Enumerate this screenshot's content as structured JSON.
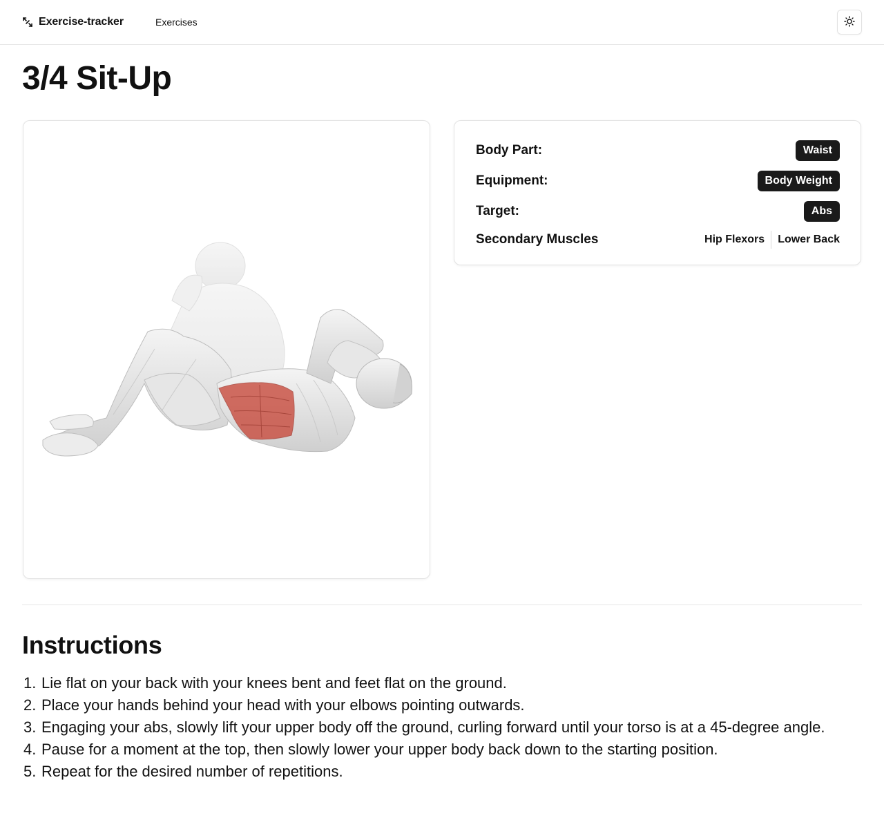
{
  "navbar": {
    "brand_icon": "arrows-diagonal-icon",
    "brand": "Exercise-tracker",
    "links": [
      "Exercises"
    ],
    "theme_toggle_icon": "sun-icon"
  },
  "exercise": {
    "title": "3/4 Sit-Up",
    "illustration": "situp-illustration",
    "details": {
      "body_part_label": "Body Part:",
      "body_part": "Waist",
      "equipment_label": "Equipment:",
      "equipment": "Body Weight",
      "target_label": "Target:",
      "target": "Abs",
      "secondary_label": "Secondary Muscles",
      "secondary_muscles": [
        "Hip Flexors",
        "Lower Back"
      ]
    }
  },
  "instructions": {
    "heading": "Instructions",
    "steps": [
      "Lie flat on your back with your knees bent and feet flat on the ground.",
      "Place your hands behind your head with your elbows pointing outwards.",
      "Engaging your abs, slowly lift your upper body off the ground, curling forward until your torso is at a 45-degree angle.",
      "Pause for a moment at the top, then slowly lower your upper body back down to the starting position.",
      "Repeat for the desired number of repetitions."
    ],
    "numbers": [
      "1.",
      "2.",
      "3.",
      "4.",
      "5."
    ]
  },
  "colors": {
    "badge_bg": "#1a1a1a",
    "muscle_highlight": "#c8483a",
    "border": "#e3e3e3"
  }
}
